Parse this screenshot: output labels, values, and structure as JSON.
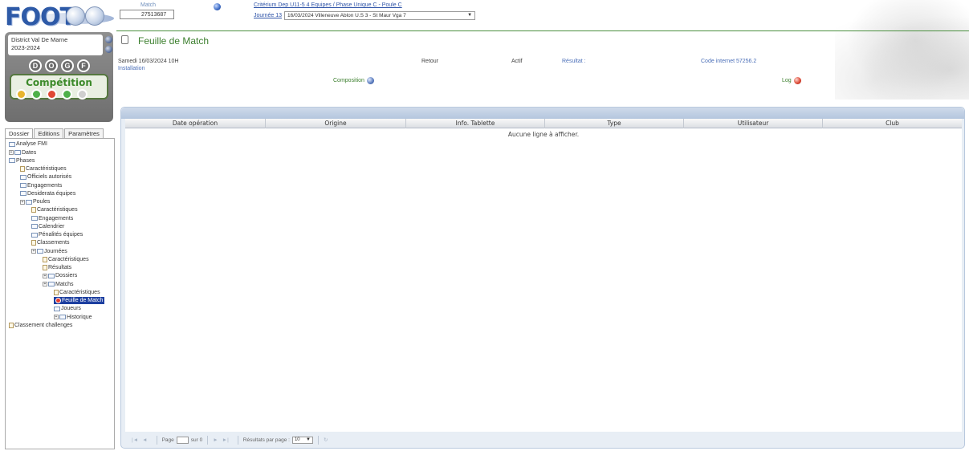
{
  "logo": {
    "text": "FOOT"
  },
  "topbar": {
    "match_label": "Match",
    "match_number": "27513687",
    "criterium_link": "Critérium Dep U11-5 4 Equipes / Phase Unique  C - Poule C",
    "journee_link": "Journée 13",
    "journee_select": "16/03/2024 Villeneuve Ablon U.S 3 - St Maur Vga 7"
  },
  "left": {
    "district_name": "District Val De Marne",
    "season": "2023-2024",
    "circle_buttons": [
      "D",
      "O",
      "G",
      "F"
    ],
    "competition_title": "Compétition",
    "competition_dots": [
      "#e8b52f",
      "#4fb04a",
      "#e04834",
      "#4fb04a",
      "#cfcfcf"
    ],
    "tabs": [
      "Dossier",
      "Editions",
      "Paramètres"
    ]
  },
  "tree": [
    {
      "label": "Analyse FMI",
      "type": "folder"
    },
    {
      "label": "Dates",
      "type": "folder"
    },
    {
      "label": "Phases",
      "type": "folder"
    },
    {
      "label": "Caractéristiques",
      "type": "page"
    },
    {
      "label": "Officiels autorisés",
      "type": "folder"
    },
    {
      "label": "Engagements",
      "type": "folder"
    },
    {
      "label": "Desiderata équipes",
      "type": "folder"
    },
    {
      "label": "Poules",
      "type": "folder"
    },
    {
      "label": "Caractéristiques",
      "type": "page"
    },
    {
      "label": "Engagements",
      "type": "folder"
    },
    {
      "label": "Calendrier",
      "type": "folder"
    },
    {
      "label": "Pénalités équipes",
      "type": "folder"
    },
    {
      "label": "Classements",
      "type": "page"
    },
    {
      "label": "Journées",
      "type": "folder"
    },
    {
      "label": "Caractéristiques",
      "type": "page"
    },
    {
      "label": "Résultats",
      "type": "page"
    },
    {
      "label": "Dossiers",
      "type": "folder"
    },
    {
      "label": "Matchs",
      "type": "folder"
    },
    {
      "label": "Caractéristiques",
      "type": "page"
    },
    {
      "label": "Feuille de Match",
      "type": "selected"
    },
    {
      "label": "Joueurs",
      "type": "folder"
    },
    {
      "label": "Historique",
      "type": "folder"
    },
    {
      "label": "Classement challenges",
      "type": "page"
    }
  ],
  "header": {
    "title": "Feuille de Match",
    "date": "Samedi 16/03/2024 10H",
    "installation": "Installation",
    "retour": "Retour",
    "actif": "Actif",
    "resultat": "Résultat :",
    "code_internet": "Code internet 57256.2",
    "composition": "Composition",
    "log": "Log"
  },
  "grid": {
    "columns": [
      "Date opération",
      "Origine",
      "Info. Tablette",
      "Type",
      "Utilisateur",
      "Club"
    ],
    "empty_message": "Aucune ligne à afficher."
  },
  "pager": {
    "first": "|◄",
    "prev": "◄",
    "page_label": "Page",
    "page_value": "",
    "of_label": "sur 0",
    "next": "►",
    "last": "►|",
    "per_page_label": "Résultats par page :",
    "per_page_value": "10",
    "refresh": "↻"
  }
}
